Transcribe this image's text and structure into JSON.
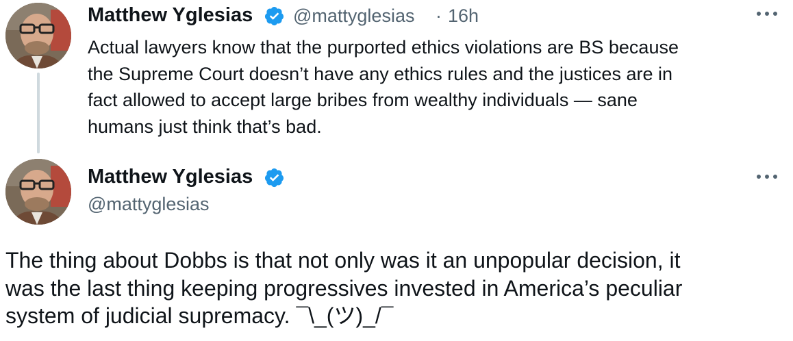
{
  "tweet1": {
    "author_name": "Matthew Yglesias",
    "handle": "@mattyglesias",
    "separator": "·",
    "time": "16h",
    "verified_icon": "verified-badge-icon",
    "more_icon": "more-dots-icon",
    "text_lines": [
      "Actual lawyers know that the purported ethics violations are BS because",
      "the Supreme Court doesn’t have any ethics rules and the justices are in",
      "fact allowed to accept large bribes from wealthy individuals — sane",
      "humans just think that’s bad."
    ]
  },
  "tweet2": {
    "author_name": "Matthew Yglesias",
    "handle": "@mattyglesias",
    "verified_icon": "verified-badge-icon",
    "more_icon": "more-dots-icon",
    "text_lines": [
      "The thing about Dobbs is that not only was it an unpopular decision, it",
      "was the last thing keeping progressives invested in America’s peculiar",
      "system of judicial supremacy. ¯\\_(ツ)_/¯"
    ]
  },
  "colors": {
    "text": "#0f1419",
    "secondary": "#536471",
    "verified": "#1d9bf0",
    "thread_line": "#cfd9de"
  }
}
